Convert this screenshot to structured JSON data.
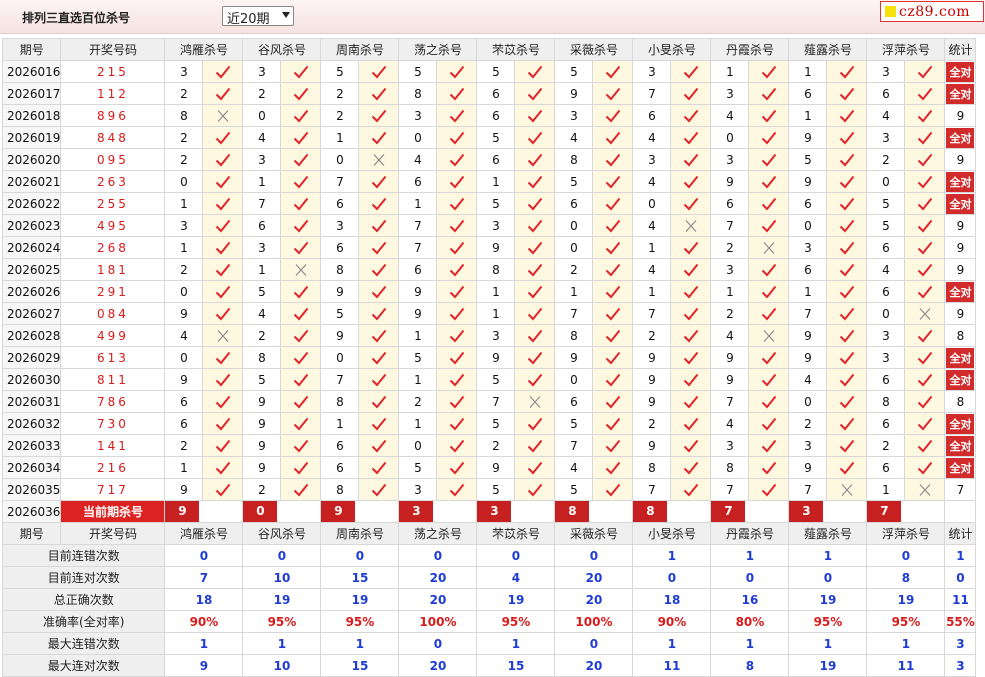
{
  "header": {
    "title": "排列三直选百位杀号",
    "select_value": "近20期",
    "logo_text": "cz89.com"
  },
  "columns": {
    "period": "期号",
    "draw": "开奖号码",
    "stat": "统计",
    "experts": [
      "鸿雁杀号",
      "谷风杀号",
      "周南杀号",
      "荡之杀号",
      "芣苡杀号",
      "采薇杀号",
      "小旻杀号",
      "丹霞杀号",
      "薤露杀号",
      "浮萍杀号"
    ]
  },
  "rows": [
    {
      "p": "2026016",
      "d": "215",
      "k": [
        "3",
        "3",
        "5",
        "5",
        "5",
        "5",
        "3",
        "1",
        "1",
        "3"
      ],
      "r": "11111111111",
      "s": "全对"
    },
    {
      "p": "2026017",
      "d": "112",
      "k": [
        "2",
        "2",
        "2",
        "8",
        "6",
        "9",
        "7",
        "3",
        "6",
        "6"
      ],
      "r": "11111111111",
      "s": "全对"
    },
    {
      "p": "2026018",
      "d": "896",
      "k": [
        "8",
        "0",
        "2",
        "3",
        "6",
        "3",
        "6",
        "4",
        "1",
        "4"
      ],
      "r": "01111111111",
      "s": "9"
    },
    {
      "p": "2026019",
      "d": "848",
      "k": [
        "2",
        "4",
        "1",
        "0",
        "5",
        "4",
        "4",
        "0",
        "9",
        "3"
      ],
      "r": "11111111111",
      "s": "全对"
    },
    {
      "p": "2026020",
      "d": "095",
      "k": [
        "2",
        "3",
        "0",
        "4",
        "6",
        "8",
        "3",
        "3",
        "5",
        "2"
      ],
      "r": "11011111111",
      "s": "9"
    },
    {
      "p": "2026021",
      "d": "263",
      "k": [
        "0",
        "1",
        "7",
        "6",
        "1",
        "5",
        "4",
        "9",
        "9",
        "0"
      ],
      "r": "11111111111",
      "s": "全对"
    },
    {
      "p": "2026022",
      "d": "255",
      "k": [
        "1",
        "7",
        "6",
        "1",
        "5",
        "6",
        "0",
        "6",
        "6",
        "5"
      ],
      "r": "11111111111",
      "s": "全对"
    },
    {
      "p": "2026023",
      "d": "495",
      "k": [
        "3",
        "6",
        "3",
        "7",
        "3",
        "0",
        "4",
        "7",
        "0",
        "5"
      ],
      "r": "11111101111",
      "s": "9"
    },
    {
      "p": "2026024",
      "d": "268",
      "k": [
        "1",
        "3",
        "6",
        "7",
        "9",
        "0",
        "1",
        "2",
        "3",
        "6"
      ],
      "r": "11111110111",
      "s": "9"
    },
    {
      "p": "2026025",
      "d": "181",
      "k": [
        "2",
        "1",
        "8",
        "6",
        "8",
        "2",
        "4",
        "3",
        "6",
        "4"
      ],
      "r": "10111111111",
      "s": "9"
    },
    {
      "p": "2026026",
      "d": "291",
      "k": [
        "0",
        "5",
        "9",
        "9",
        "1",
        "1",
        "1",
        "1",
        "1",
        "6"
      ],
      "r": "11111111111",
      "s": "全对"
    },
    {
      "p": "2026027",
      "d": "084",
      "k": [
        "9",
        "4",
        "5",
        "9",
        "1",
        "7",
        "7",
        "2",
        "7",
        "0"
      ],
      "r": "11111111101",
      "s": "9"
    },
    {
      "p": "2026028",
      "d": "499",
      "k": [
        "4",
        "2",
        "9",
        "1",
        "3",
        "8",
        "2",
        "4",
        "9",
        "3"
      ],
      "r": "01111110111",
      "s": "8"
    },
    {
      "p": "2026029",
      "d": "613",
      "k": [
        "0",
        "8",
        "0",
        "5",
        "9",
        "9",
        "9",
        "9",
        "9",
        "3"
      ],
      "r": "11111111111",
      "s": "全对"
    },
    {
      "p": "2026030",
      "d": "811",
      "k": [
        "9",
        "5",
        "7",
        "1",
        "5",
        "0",
        "9",
        "9",
        "4",
        "6"
      ],
      "r": "11111111111",
      "s": "全对"
    },
    {
      "p": "2026031",
      "d": "786",
      "k": [
        "6",
        "9",
        "8",
        "2",
        "7",
        "6",
        "9",
        "7",
        "0",
        "8"
      ],
      "r": "11110111111",
      "s": "8"
    },
    {
      "p": "2026032",
      "d": "730",
      "k": [
        "6",
        "9",
        "1",
        "1",
        "5",
        "5",
        "2",
        "4",
        "2",
        "6"
      ],
      "r": "11111111111",
      "s": "全对"
    },
    {
      "p": "2026033",
      "d": "141",
      "k": [
        "2",
        "9",
        "6",
        "0",
        "2",
        "7",
        "9",
        "3",
        "3",
        "2"
      ],
      "r": "11111111111",
      "s": "全对"
    },
    {
      "p": "2026034",
      "d": "216",
      "k": [
        "1",
        "9",
        "6",
        "5",
        "9",
        "4",
        "8",
        "8",
        "9",
        "6"
      ],
      "r": "11111111111",
      "s": "全对"
    },
    {
      "p": "2026035",
      "d": "717",
      "k": [
        "9",
        "2",
        "8",
        "3",
        "5",
        "5",
        "7",
        "7",
        "7",
        "1"
      ],
      "r": "11111111001",
      "s": "7"
    }
  ],
  "current": {
    "p": "2026036",
    "label": "当前期杀号",
    "k": [
      "9",
      "0",
      "9",
      "3",
      "3",
      "8",
      "8",
      "7",
      "3",
      "7"
    ]
  },
  "stats": [
    {
      "label": "目前连错次数",
      "v": [
        "0",
        "0",
        "0",
        "0",
        "0",
        "0",
        "1",
        "1",
        "1",
        "0",
        "1"
      ],
      "color": "blue"
    },
    {
      "label": "目前连对次数",
      "v": [
        "7",
        "10",
        "15",
        "20",
        "4",
        "20",
        "0",
        "0",
        "0",
        "8",
        "0"
      ],
      "color": "blue"
    },
    {
      "label": "总正确次数",
      "v": [
        "18",
        "19",
        "19",
        "20",
        "19",
        "20",
        "18",
        "16",
        "19",
        "19",
        "11"
      ],
      "color": "blue"
    },
    {
      "label": "准确率(全对率)",
      "v": [
        "90%",
        "95%",
        "95%",
        "100%",
        "95%",
        "100%",
        "90%",
        "80%",
        "95%",
        "95%",
        "55%"
      ],
      "color": "red"
    },
    {
      "label": "最大连错次数",
      "v": [
        "1",
        "1",
        "1",
        "0",
        "1",
        "0",
        "1",
        "1",
        "1",
        "1",
        "3"
      ],
      "color": "blue"
    },
    {
      "label": "最大连对次数",
      "v": [
        "9",
        "10",
        "15",
        "20",
        "15",
        "20",
        "11",
        "8",
        "19",
        "11",
        "3"
      ],
      "color": "blue"
    }
  ],
  "icons": {
    "correct": "check-icon",
    "wrong": "cross-icon"
  },
  "colors": {
    "check": "#e0242a",
    "cross": "#8c8c8c",
    "badge": "#d22b2b",
    "accent_red": "#d81b1b",
    "accent_blue": "#1f3bd6"
  }
}
